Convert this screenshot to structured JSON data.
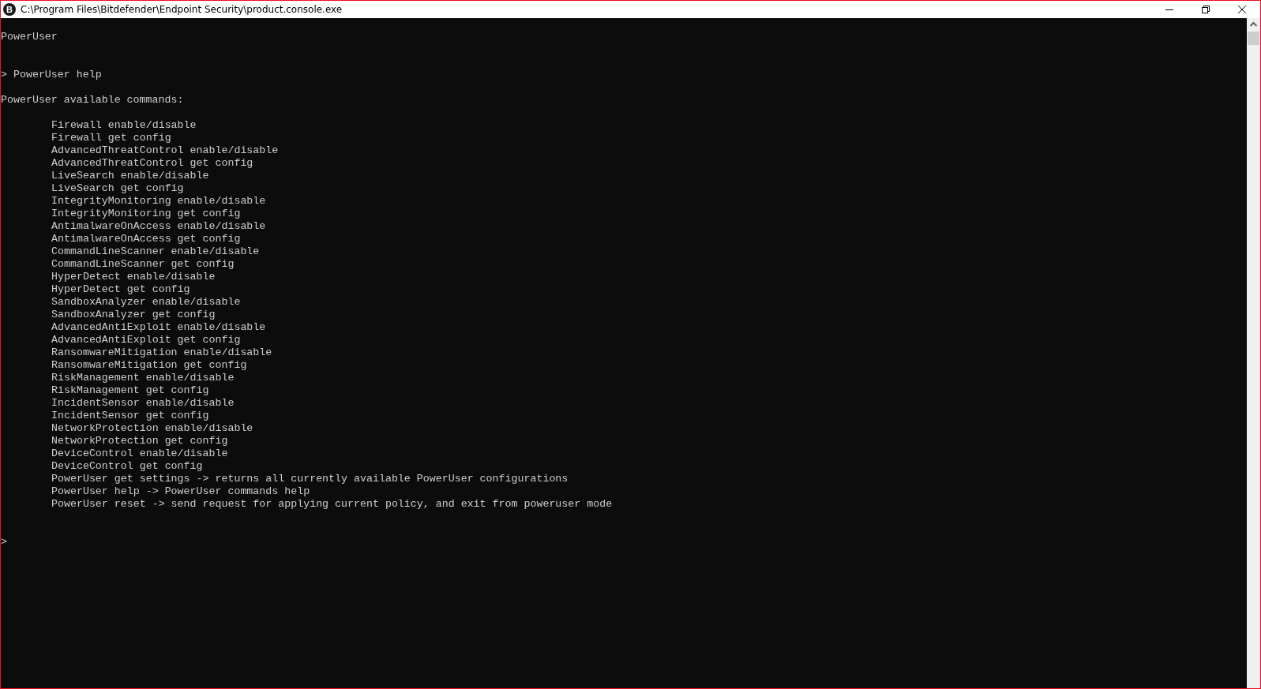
{
  "window": {
    "title": "C:\\Program Files\\Bitdefender\\Endpoint Security\\product.console.exe",
    "icon_letter": "B"
  },
  "console": [
    {
      "kind": "banner",
      "text": "PowerUser"
    },
    {
      "kind": "echo",
      "text": "> PowerUser help"
    },
    {
      "kind": "heading",
      "text": "PowerUser available commands:"
    },
    {
      "kind": "list",
      "items": [
        "Firewall enable/disable",
        "Firewall get config",
        "AdvancedThreatControl enable/disable",
        "AdvancedThreatControl get config",
        "LiveSearch enable/disable",
        "LiveSearch get config",
        "IntegrityMonitoring enable/disable",
        "IntegrityMonitoring get config",
        "AntimalwareOnAccess enable/disable",
        "AntimalwareOnAccess get config",
        "CommandLineScanner enable/disable",
        "CommandLineScanner get config",
        "HyperDetect enable/disable",
        "HyperDetect get config",
        "SandboxAnalyzer enable/disable",
        "SandboxAnalyzer get config",
        "AdvancedAntiExploit enable/disable",
        "AdvancedAntiExploit get config",
        "RansomwareMitigation enable/disable",
        "RansomwareMitigation get config",
        "RiskManagement enable/disable",
        "RiskManagement get config",
        "IncidentSensor enable/disable",
        "IncidentSensor get config",
        "NetworkProtection enable/disable",
        "NetworkProtection get config",
        "DeviceControl enable/disable",
        "DeviceControl get config",
        "PowerUser get settings -> returns all currently available PowerUser configurations",
        "PowerUser help -> PowerUser commands help",
        "PowerUser reset -> send request for applying current policy, and exit from poweruser mode"
      ]
    },
    {
      "kind": "prompt",
      "text": ">"
    }
  ]
}
